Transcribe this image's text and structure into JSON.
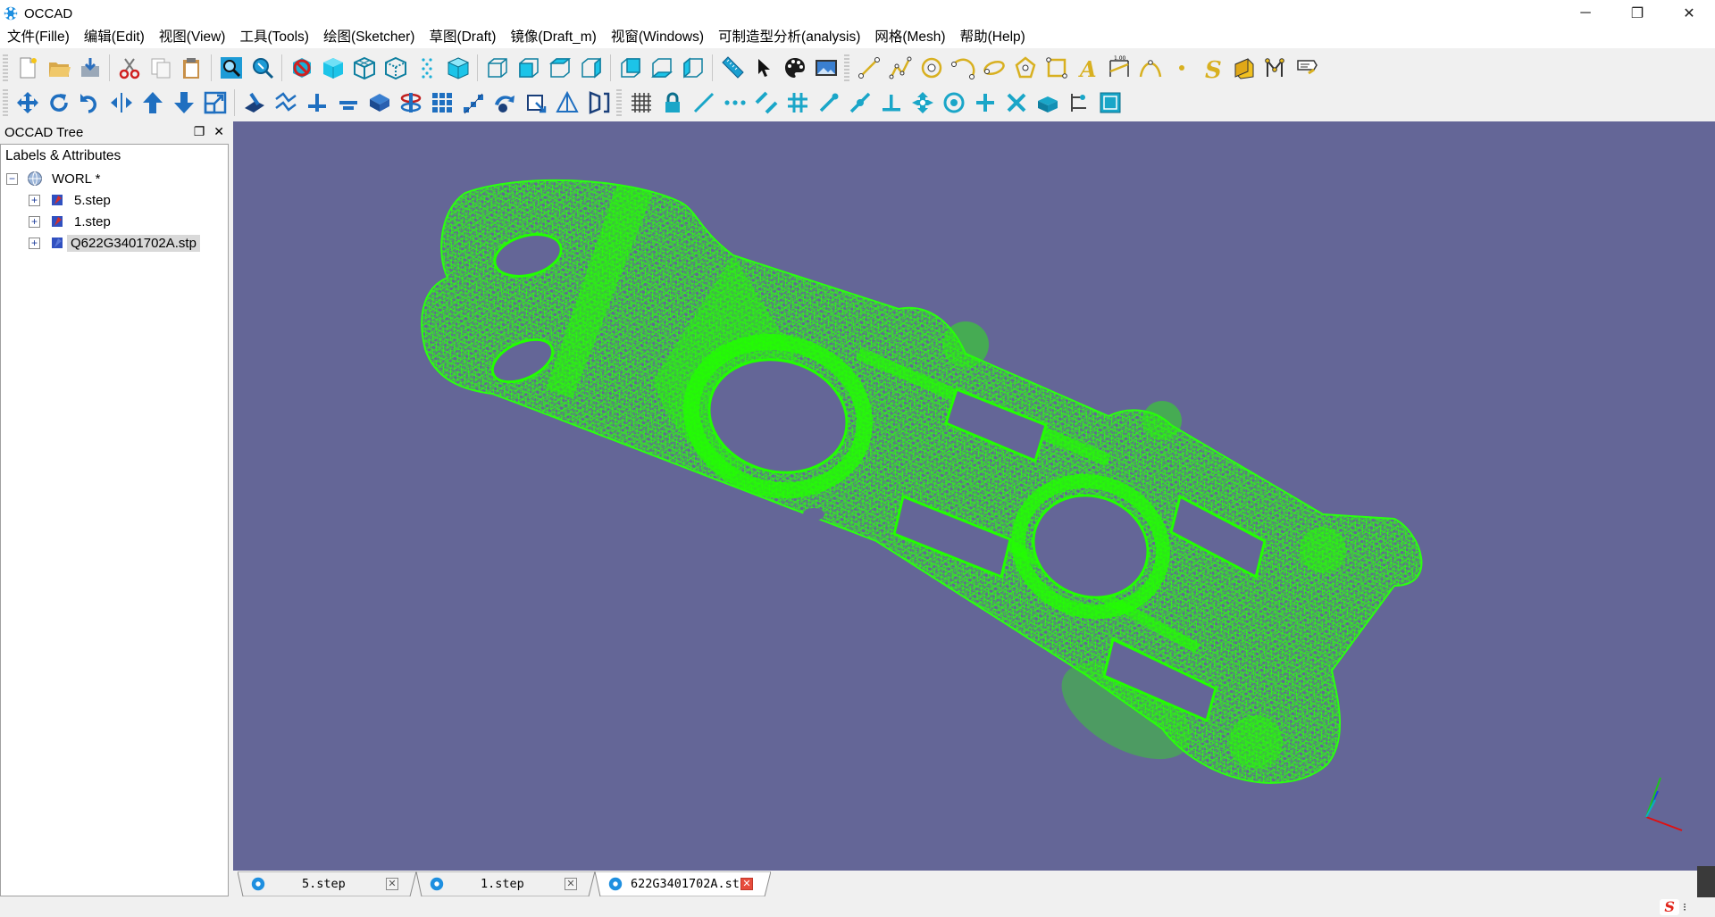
{
  "window": {
    "title": "OCCAD",
    "controls": {
      "minimize": "─",
      "restore": "❐",
      "close": "✕"
    }
  },
  "menu": [
    "文件(Fille)",
    "编辑(Edit)",
    "视图(View)",
    "工具(Tools)",
    "绘图(Sketcher)",
    "草图(Draft)",
    "镜像(Draft_m)",
    "视窗(Windows)",
    "可制造型分析(analysis)",
    "网格(Mesh)",
    "帮助(Help)"
  ],
  "toolbar1_icons": [
    "new-file-icon",
    "open-folder-icon",
    "save-icon",
    "cut-icon",
    "copy-icon",
    "paste-icon",
    "zoom-fit-icon",
    "zoom-window-icon",
    "no-shading-icon",
    "shaded-cube-icon",
    "wireframe-cube-icon",
    "hidden-line-icon",
    "points-icon",
    "solid-cube-icon",
    "view-front-icon",
    "view-top-icon",
    "view-right-icon",
    "view-iso-icon",
    "view-back-icon",
    "view-bottom-icon",
    "view-left-icon",
    "measure-ruler-icon",
    "select-cursor-icon",
    "color-palette-icon",
    "background-image-icon",
    "line-icon",
    "polyline-icon",
    "circle-icon",
    "arc-icon",
    "ellipse-icon",
    "polygon-icon",
    "rectangle-icon",
    "text-icon",
    "dimension-icon",
    "bspline-icon",
    "point-icon",
    "spline-s-icon",
    "face-icon",
    "wire-icon",
    "annotation-icon"
  ],
  "toolbar2_icons": [
    "move-icon",
    "rotate-icon",
    "undo-rotate-icon",
    "mirror-icon",
    "arrow-up-icon",
    "arrow-down-icon",
    "scale-icon",
    "extrude-icon",
    "offset-icon",
    "upgrade-icon",
    "downgrade-icon",
    "boolean-icon",
    "revolve-icon",
    "array-icon",
    "path-array-icon",
    "clone-icon",
    "draft-to-sketch-icon",
    "shape2d-icon",
    "flip-icon",
    "grid-icon",
    "lock-icon",
    "snap-line-icon",
    "snap-dots-icon",
    "snap-parallel-icon",
    "snap-grid-icon",
    "snap-endpoint-icon",
    "snap-midpoint-icon",
    "snap-perpendicular-icon",
    "snap-extension-icon",
    "snap-center-icon",
    "snap-plus-icon",
    "snap-intersection-icon",
    "snap-working-plane-icon",
    "snap-dimension-icon",
    "snap-special-icon"
  ],
  "dock": {
    "title": "OCCAD Tree",
    "tree_header": "Labels & Attributes",
    "root": {
      "label": "WORL *",
      "expander": "−"
    },
    "children": [
      {
        "label": "5.step",
        "expander": "+"
      },
      {
        "label": "1.step",
        "expander": "+"
      },
      {
        "label": "Q622G3401702A.stp",
        "expander": "+",
        "selected": true
      }
    ]
  },
  "viewport": {
    "background": "#646697",
    "mesh_color": "#22ff00",
    "axis_colors": {
      "x": "#e01010",
      "y": "#20c020",
      "z": "#2040e0"
    }
  },
  "tabs": [
    {
      "label": "5.step",
      "close": "✕"
    },
    {
      "label": "1.step",
      "close": "✕"
    },
    {
      "label": "622G3401702A.st",
      "close": "✕",
      "active": true
    }
  ],
  "ime": {
    "logo": "S",
    "mode": "⁝"
  }
}
